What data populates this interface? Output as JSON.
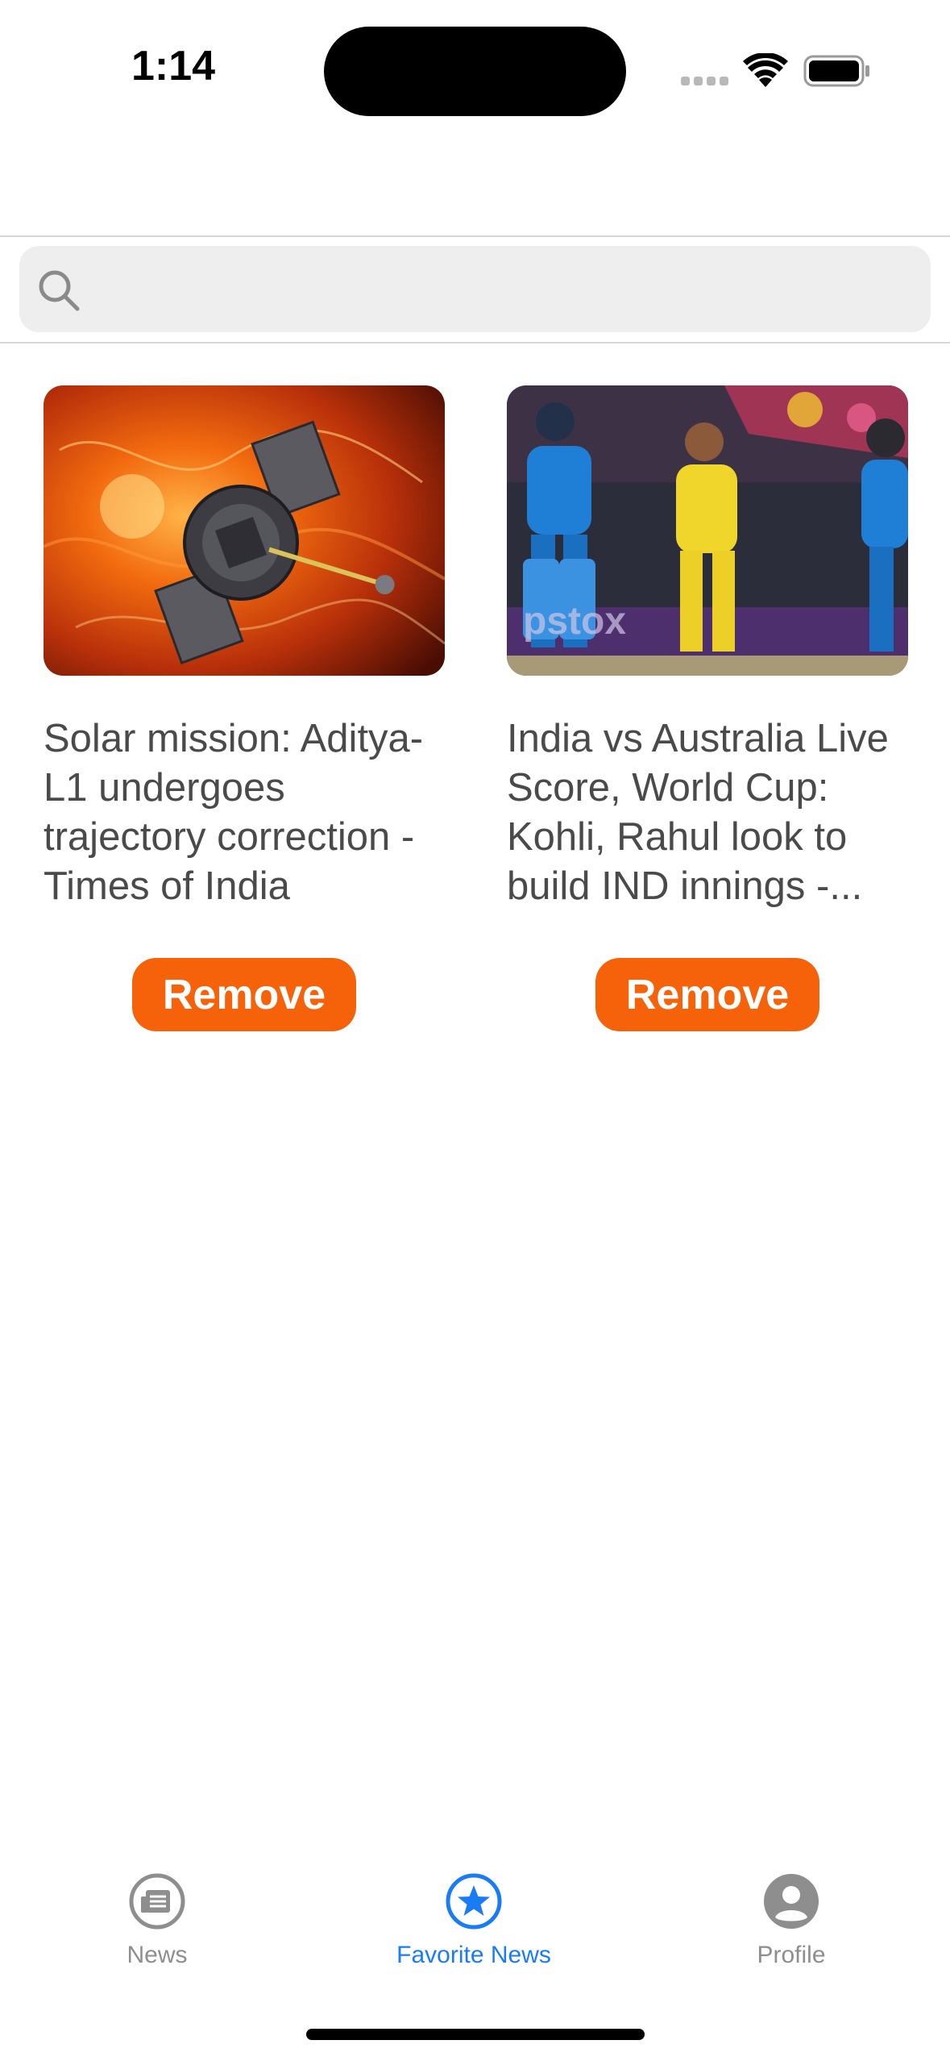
{
  "status_bar": {
    "time": "1:14"
  },
  "search": {
    "placeholder": ""
  },
  "favorites": [
    {
      "image": "solar-probe-photo",
      "title": "Solar mission: Aditya-L1 undergoes trajectory correction - Times of India",
      "button": "Remove"
    },
    {
      "image": "cricket-players-photo",
      "title": "India vs Australia Live Score, World Cup: Kohli, Rahul look to build IND innings -...",
      "button": "Remove"
    }
  ],
  "tabbar": {
    "items": [
      {
        "label": "News",
        "icon": "newspaper-icon",
        "active": false
      },
      {
        "label": "Favorite News",
        "icon": "star-icon",
        "active": true
      },
      {
        "label": "Profile",
        "icon": "profile-icon",
        "active": false
      }
    ]
  },
  "colors": {
    "accent": "#f5620a",
    "active_tab": "#1a7cf5",
    "inactive_tab": "#8e8e8e"
  }
}
